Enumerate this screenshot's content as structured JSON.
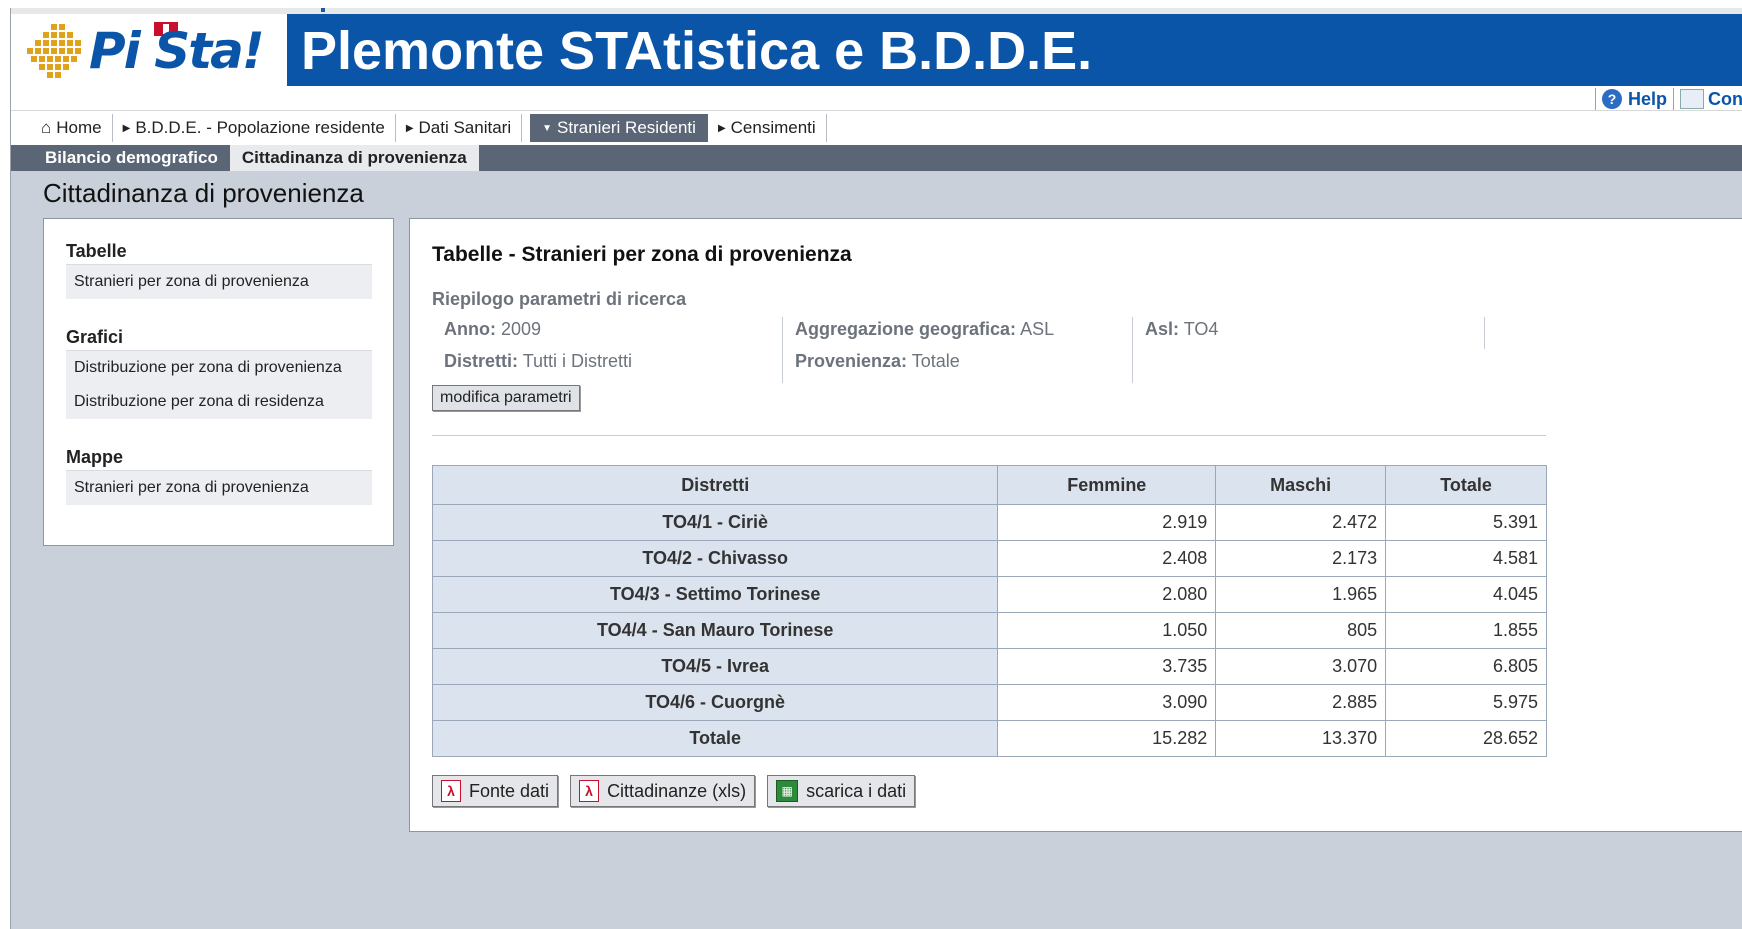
{
  "banner": {
    "logo_text": "Pi Sta!",
    "title": "Plemonte STAtistica e B.D.D.E."
  },
  "util": {
    "help": "Help",
    "con": "Con"
  },
  "nav": [
    {
      "label": "Home",
      "icon": "home-icon"
    },
    {
      "label": "B.D.D.E. - Popolazione residente",
      "icon": "triangle-right-icon"
    },
    {
      "label": "Dati Sanitari",
      "icon": "triangle-right-icon"
    },
    {
      "label": "Stranieri Residenti",
      "icon": "triangle-down-icon",
      "active": true
    },
    {
      "label": "Censimenti",
      "icon": "triangle-right-icon"
    }
  ],
  "subnav": [
    {
      "label": "Bilancio demografico"
    },
    {
      "label": "Cittadinanza di provenienza",
      "active": true
    }
  ],
  "page_title": "Cittadinanza di provenienza",
  "left_panel": {
    "tabelle_title": "Tabelle",
    "tabelle_items": [
      "Stranieri per zona di provenienza"
    ],
    "grafici_title": "Grafici",
    "grafici_items": [
      "Distribuzione per zona di provenienza",
      "Distribuzione per zona di residenza"
    ],
    "mappe_title": "Mappe",
    "mappe_items": [
      "Stranieri per zona di provenienza"
    ]
  },
  "right_panel": {
    "title": "Tabelle - Stranieri per zona di provenienza",
    "summary_title": "Riepilogo parametri di ricerca",
    "params": {
      "anno_label": "Anno:",
      "anno_value": "2009",
      "distretti_label": "Distretti:",
      "distretti_value": "Tutti i Distretti",
      "aggregazione_label": "Aggregazione geografica:",
      "aggregazione_value": "ASL",
      "provenienza_label": "Provenienza:",
      "provenienza_value": "Totale",
      "asl_label": "Asl:",
      "asl_value": "TO4"
    },
    "modify_button": "modifica parametri",
    "table": {
      "headers": [
        "Distretti",
        "Femmine",
        "Maschi",
        "Totale"
      ],
      "rows": [
        [
          "TO4/1 - Ciriè",
          "2.919",
          "2.472",
          "5.391"
        ],
        [
          "TO4/2 - Chivasso",
          "2.408",
          "2.173",
          "4.581"
        ],
        [
          "TO4/3 - Settimo Torinese",
          "2.080",
          "1.965",
          "4.045"
        ],
        [
          "TO4/4 - San Mauro Torinese",
          "1.050",
          "805",
          "1.855"
        ],
        [
          "TO4/5 - Ivrea",
          "3.735",
          "3.070",
          "6.805"
        ],
        [
          "TO4/6 - Cuorgnè",
          "3.090",
          "2.885",
          "5.975"
        ],
        [
          "Totale",
          "15.282",
          "13.370",
          "28.652"
        ]
      ]
    },
    "actions": [
      {
        "label": "Fonte dati",
        "icon": "pdf-icon"
      },
      {
        "label": "Cittadinanze (xls)",
        "icon": "pdf-icon"
      },
      {
        "label": "scarica i dati",
        "icon": "spreadsheet-icon"
      }
    ]
  },
  "colors": {
    "banner_blue": "#0b55a8",
    "nav_gray": "#5a6676",
    "table_header": "#dbe3ee",
    "page_bg": "#c9d0d9"
  }
}
